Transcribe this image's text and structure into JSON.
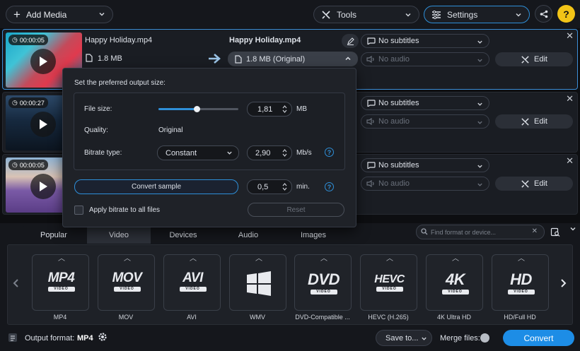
{
  "toolbar": {
    "add_media_label": "Add Media",
    "tools_label": "Tools",
    "settings_label": "Settings",
    "help_label": "?"
  },
  "files": [
    {
      "duration": "00:00:05",
      "name": "Happy Holiday.mp4",
      "size": "1.8 MB",
      "output_name": "Happy Holiday.mp4",
      "output_size": "1.8 MB (Original)",
      "subtitles": "No subtitles",
      "audio": "No audio",
      "edit_label": "Edit"
    },
    {
      "duration": "00:00:27",
      "subtitles": "No subtitles",
      "audio": "No audio",
      "edit_label": "Edit"
    },
    {
      "duration": "00:00:05",
      "subtitles": "No subtitles",
      "audio": "No audio",
      "edit_label": "Edit"
    }
  ],
  "popover": {
    "title": "Set the preferred output size:",
    "file_size_label": "File size:",
    "file_size_value": "1,81",
    "file_size_unit": "MB",
    "file_size_slider_fraction": 0.48,
    "quality_label": "Quality:",
    "quality_value": "Original",
    "bitrate_type_label": "Bitrate type:",
    "bitrate_type_value": "Constant",
    "bitrate_value": "2,90",
    "bitrate_unit": "Mb/s",
    "convert_sample_label": "Convert sample",
    "sample_value": "0,5",
    "sample_unit": "min.",
    "apply_all_label": "Apply bitrate to all files",
    "reset_label": "Reset"
  },
  "format_tabs": [
    "Popular",
    "Video",
    "Devices",
    "Audio",
    "Images"
  ],
  "active_tab": "Video",
  "format_search_placeholder": "Find format or device...",
  "formats": [
    {
      "logo": "MP4",
      "label": "MP4"
    },
    {
      "logo": "MOV",
      "label": "MOV"
    },
    {
      "logo": "AVI",
      "label": "AVI"
    },
    {
      "logo": "windows",
      "label": "WMV"
    },
    {
      "logo": "DVD",
      "label": "DVD-Compatible ..."
    },
    {
      "logo": "HEVC",
      "label": "HEVC (H.265)"
    },
    {
      "logo": "4K",
      "label": "4K Ultra HD"
    },
    {
      "logo": "HD",
      "label": "HD/Full HD"
    }
  ],
  "logo_sub": "VIDEO",
  "bottom": {
    "output_format_label": "Output format:",
    "output_format_value": "MP4",
    "save_to_label": "Save to...",
    "merge_files_label": "Merge files:",
    "convert_label": "Convert"
  },
  "colors": {
    "accent": "#1d8de6",
    "help": "#f2c417"
  }
}
